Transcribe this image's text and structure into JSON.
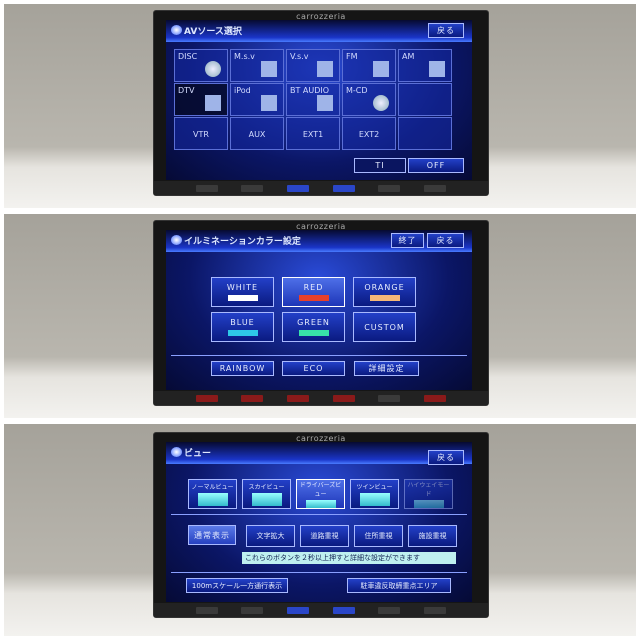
{
  "brand": "carrozzeria",
  "av": {
    "title": "AVソース選択",
    "back": "戻る",
    "sources": [
      "DISC",
      "M.s.v",
      "V.s.v",
      "FM",
      "AM",
      "DTV",
      "iPod",
      "BT AUDIO",
      "M-CD",
      "",
      "VTR",
      "AUX",
      "EXT1",
      "EXT2",
      ""
    ],
    "ti": "TI",
    "off": "OFF"
  },
  "illum": {
    "title": "イルミネーションカラー設定",
    "end": "終了",
    "back": "戻る",
    "colors": [
      {
        "label": "WHITE",
        "swatch": "#ffffff"
      },
      {
        "label": "RED",
        "swatch": "#e8402a"
      },
      {
        "label": "ORANGE",
        "swatch": "#f4b878"
      },
      {
        "label": "BLUE",
        "swatch": "#2ec8e8"
      },
      {
        "label": "GREEN",
        "swatch": "#38e0a8"
      },
      {
        "label": "CUSTOM"
      }
    ],
    "selected": "RED",
    "rainbow": "RAINBOW",
    "eco": "ECO",
    "detail": "詳細設定"
  },
  "view": {
    "title": "ビュー",
    "back": "戻る",
    "modes": [
      "ノーマルビュー",
      "スカイビュー",
      "ドライバーズビュー",
      "ツインビュー",
      "ハイウェイモード"
    ],
    "selected": "ドライバーズビュー",
    "normal": "通常表示",
    "options": [
      "文字拡大",
      "道路重視",
      "住所重視",
      "施設重視"
    ],
    "hint": "これらのボタンを２秒以上押すと詳細な設定ができます",
    "scale": "100mスケール一方通行表示",
    "parking": "駐車違反取締重点エリア"
  }
}
